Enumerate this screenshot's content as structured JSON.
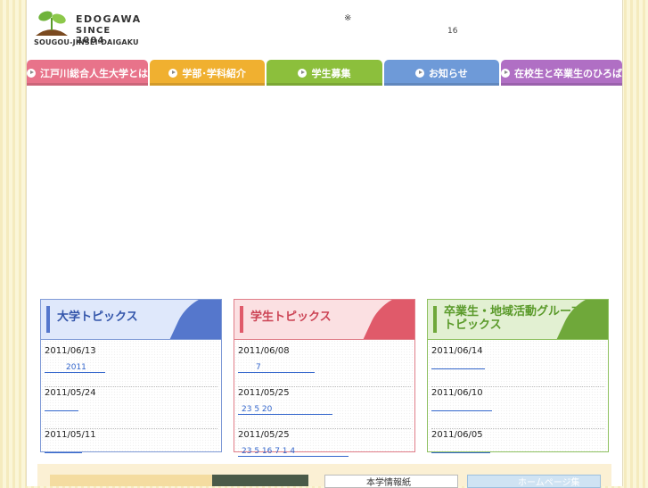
{
  "header": {
    "logo": {
      "line1": "EDOGAWA",
      "line2": "SINCE 2004",
      "line3": "SOUGOU-JINSEI-DAIGAKU"
    },
    "asterisk": "※",
    "count": "16"
  },
  "nav": [
    {
      "label": "江戸川総合人生大学とは",
      "color": "#e8738a"
    },
    {
      "label": "学部･学科紹介",
      "color": "#f0b030"
    },
    {
      "label": "学生募集",
      "color": "#8cbf3c"
    },
    {
      "label": "お知らせ",
      "color": "#6e9ad8"
    },
    {
      "label": "在校生と卒業生のひろば",
      "color": "#b06fc4"
    }
  ],
  "panels": [
    {
      "title": "大学トピックス",
      "accent": "#5577cc",
      "bg": "#dfe8fb",
      "border": "#7f9ad6",
      "entries": [
        {
          "date": "2011/06/13",
          "link": "2011"
        },
        {
          "date": "2011/05/24",
          "link": ""
        },
        {
          "date": "2011/05/11",
          "link": ""
        }
      ]
    },
    {
      "title": "学生トピックス",
      "accent": "#e05a6a",
      "bg": "#fbe0e2",
      "border": "#e07d88",
      "entries": [
        {
          "date": "2011/06/08",
          "link": "7"
        },
        {
          "date": "2011/05/25",
          "link": "23 5 20"
        },
        {
          "date": "2011/05/25",
          "link": "23 5 16 7 1 4"
        }
      ]
    },
    {
      "title": "卒業生・地域活動グループトピックス",
      "title_line1": "卒業生・地域活動グループ",
      "title_line2": "トピックス",
      "accent": "#6fa83a",
      "bg": "#e2f0d2",
      "border": "#8ec060",
      "entries": [
        {
          "date": "2011/06/14",
          "link": ""
        },
        {
          "date": "2011/06/10",
          "link": ""
        },
        {
          "date": "2011/06/05",
          "link": ""
        }
      ]
    }
  ],
  "footer_banners": {
    "banner2": "本学情報紙",
    "banner3": "ホームページ集"
  }
}
